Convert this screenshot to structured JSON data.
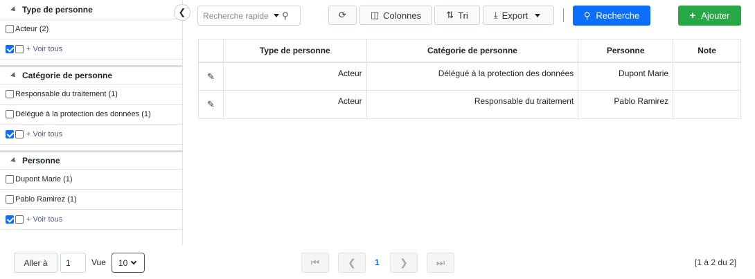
{
  "sidebar": {
    "facets": [
      {
        "title": "Type de personne",
        "items": [
          {
            "label": "Acteur (2)"
          }
        ],
        "more": "+ Voir tous"
      },
      {
        "title": "Catégorie de personne",
        "items": [
          {
            "label": "Responsable du traitement (1)"
          },
          {
            "label": "Délégué à la protection des données (1)"
          }
        ],
        "more": "+ Voir tous"
      },
      {
        "title": "Personne",
        "items": [
          {
            "label": "Dupont Marie (1)"
          },
          {
            "label": "Pablo Ramirez (1)"
          }
        ],
        "more": "+ Voir tous"
      }
    ]
  },
  "toolbar": {
    "search_placeholder": "Recherche rapide",
    "columns_label": "Colonnes",
    "sort_label": "Tri",
    "export_label": "Export",
    "search_label": "Recherche",
    "add_label": "Ajouter"
  },
  "table": {
    "headers": [
      "",
      "Type de personne",
      "Catégorie de personne",
      "Personne",
      "Note"
    ],
    "rows": [
      [
        "Acteur",
        "Délégué à la protection des données",
        "Dupont Marie",
        ""
      ],
      [
        "Acteur",
        "Responsable du traitement",
        "Pablo Ramirez",
        ""
      ]
    ]
  },
  "footer": {
    "goto_label": "Aller à",
    "goto_value": "1",
    "view_label": "Vue",
    "page_size": "10",
    "current_page": "1",
    "range_text": "[1 à 2 du 2]"
  },
  "colors": {
    "primary": "#0d6efd",
    "success": "#28a745"
  }
}
